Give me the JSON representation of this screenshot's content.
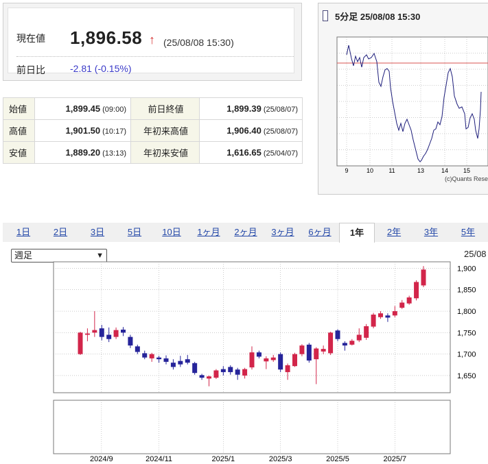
{
  "quote": {
    "current_label": "現在値",
    "current_value": "1,896.58",
    "arrow": "↑",
    "current_time": "(25/08/08 15:30)",
    "change_label": "前日比",
    "change_value": "-2.81 (-0.15%)"
  },
  "stats": {
    "rows": [
      {
        "label": "始値",
        "value": "1,899.45",
        "time": "(09:00)",
        "label2": "前日終値",
        "value2": "1,899.39",
        "time2": "(25/08/07)"
      },
      {
        "label": "高値",
        "value": "1,901.50",
        "time": "(10:17)",
        "label2": "年初来高値",
        "value2": "1,906.40",
        "time2": "(25/08/07)"
      },
      {
        "label": "安値",
        "value": "1,889.20",
        "time": "(13:13)",
        "label2": "年初来安値",
        "value2": "1,616.65",
        "time2": "(25/04/07)"
      }
    ]
  },
  "intraday": {
    "title": "5分足 25/08/08 15:30",
    "x_ticks": [
      "9",
      "10",
      "11",
      "13",
      "14",
      "15"
    ],
    "credit": "(c)Quants Rese",
    "colors": {
      "line": "#1c1c7a",
      "ref": "#d9534f",
      "grid": "#999999"
    }
  },
  "tabs": [
    "1日",
    "2日",
    "3日",
    "5日",
    "10日",
    "1ヶ月",
    "2ヶ月",
    "3ヶ月",
    "6ヶ月",
    "1年",
    "2年",
    "3年",
    "5年"
  ],
  "active_tab": "1年",
  "period_select": {
    "value": "週足"
  },
  "chart_date": "25/08",
  "chart_data": {
    "type": "candlestick",
    "x_tick_labels": [
      "2024/9",
      "2024/11",
      "2025/1",
      "2025/3",
      "2025/5",
      "2025/7"
    ],
    "y_tick_labels": [
      "1,900",
      "1,850",
      "1,800",
      "1,750",
      "1,700",
      "1,650"
    ],
    "ylim": [
      1610,
      1915
    ],
    "up_color": "#d2254a",
    "down_color": "#26249a",
    "candles": [
      {
        "o": 1700,
        "c": 1750,
        "h": 1752,
        "l": 1698
      },
      {
        "o": 1745,
        "c": 1748,
        "h": 1760,
        "l": 1730
      },
      {
        "o": 1750,
        "c": 1756,
        "h": 1800,
        "l": 1740
      },
      {
        "o": 1760,
        "c": 1740,
        "h": 1768,
        "l": 1732
      },
      {
        "o": 1745,
        "c": 1735,
        "h": 1762,
        "l": 1728
      },
      {
        "o": 1740,
        "c": 1756,
        "h": 1762,
        "l": 1735
      },
      {
        "o": 1757,
        "c": 1750,
        "h": 1763,
        "l": 1742
      },
      {
        "o": 1740,
        "c": 1720,
        "h": 1745,
        "l": 1714
      },
      {
        "o": 1718,
        "c": 1705,
        "h": 1722,
        "l": 1700
      },
      {
        "o": 1702,
        "c": 1692,
        "h": 1708,
        "l": 1688
      },
      {
        "o": 1690,
        "c": 1700,
        "h": 1703,
        "l": 1682
      },
      {
        "o": 1692,
        "c": 1688,
        "h": 1696,
        "l": 1680
      },
      {
        "o": 1690,
        "c": 1682,
        "h": 1697,
        "l": 1676
      },
      {
        "o": 1680,
        "c": 1670,
        "h": 1688,
        "l": 1664
      },
      {
        "o": 1684,
        "c": 1676,
        "h": 1696,
        "l": 1670
      },
      {
        "o": 1688,
        "c": 1680,
        "h": 1698,
        "l": 1676
      },
      {
        "o": 1679,
        "c": 1656,
        "h": 1682,
        "l": 1652
      },
      {
        "o": 1651,
        "c": 1645,
        "h": 1654,
        "l": 1640
      },
      {
        "o": 1643,
        "c": 1648,
        "h": 1650,
        "l": 1625
      },
      {
        "o": 1645,
        "c": 1662,
        "h": 1665,
        "l": 1642
      },
      {
        "o": 1665,
        "c": 1658,
        "h": 1672,
        "l": 1650
      },
      {
        "o": 1670,
        "c": 1658,
        "h": 1674,
        "l": 1652
      },
      {
        "o": 1664,
        "c": 1652,
        "h": 1668,
        "l": 1640
      },
      {
        "o": 1650,
        "c": 1665,
        "h": 1668,
        "l": 1643
      },
      {
        "o": 1669,
        "c": 1704,
        "h": 1718,
        "l": 1664
      },
      {
        "o": 1704,
        "c": 1694,
        "h": 1708,
        "l": 1690
      },
      {
        "o": 1683,
        "c": 1690,
        "h": 1695,
        "l": 1665
      },
      {
        "o": 1686,
        "c": 1692,
        "h": 1698,
        "l": 1682
      },
      {
        "o": 1700,
        "c": 1664,
        "h": 1704,
        "l": 1658
      },
      {
        "o": 1658,
        "c": 1674,
        "h": 1678,
        "l": 1640
      },
      {
        "o": 1672,
        "c": 1700,
        "h": 1703,
        "l": 1670
      },
      {
        "o": 1700,
        "c": 1720,
        "h": 1723,
        "l": 1695
      },
      {
        "o": 1722,
        "c": 1685,
        "h": 1726,
        "l": 1680
      },
      {
        "o": 1688,
        "c": 1713,
        "h": 1716,
        "l": 1630
      },
      {
        "o": 1706,
        "c": 1712,
        "h": 1720,
        "l": 1700
      },
      {
        "o": 1702,
        "c": 1750,
        "h": 1752,
        "l": 1698
      },
      {
        "o": 1755,
        "c": 1735,
        "h": 1758,
        "l": 1730
      },
      {
        "o": 1726,
        "c": 1720,
        "h": 1730,
        "l": 1708
      },
      {
        "o": 1722,
        "c": 1731,
        "h": 1735,
        "l": 1720
      },
      {
        "o": 1732,
        "c": 1745,
        "h": 1760,
        "l": 1728
      },
      {
        "o": 1738,
        "c": 1765,
        "h": 1770,
        "l": 1733
      },
      {
        "o": 1764,
        "c": 1792,
        "h": 1796,
        "l": 1760
      },
      {
        "o": 1786,
        "c": 1795,
        "h": 1800,
        "l": 1782
      },
      {
        "o": 1790,
        "c": 1785,
        "h": 1795,
        "l": 1775
      },
      {
        "o": 1790,
        "c": 1800,
        "h": 1812,
        "l": 1786
      },
      {
        "o": 1808,
        "c": 1820,
        "h": 1826,
        "l": 1805
      },
      {
        "o": 1818,
        "c": 1832,
        "h": 1836,
        "l": 1815
      },
      {
        "o": 1830,
        "c": 1868,
        "h": 1872,
        "l": 1825
      },
      {
        "o": 1860,
        "c": 1897,
        "h": 1905,
        "l": 1856
      }
    ]
  }
}
